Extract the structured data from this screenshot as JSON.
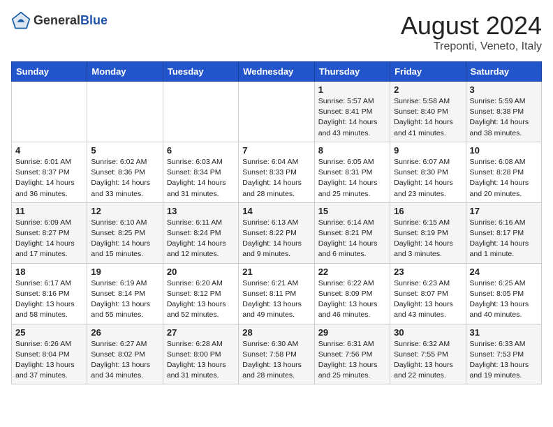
{
  "header": {
    "logo_general": "General",
    "logo_blue": "Blue",
    "month_year": "August 2024",
    "location": "Treponti, Veneto, Italy"
  },
  "days_of_week": [
    "Sunday",
    "Monday",
    "Tuesday",
    "Wednesday",
    "Thursday",
    "Friday",
    "Saturday"
  ],
  "weeks": [
    [
      {
        "day": "",
        "info": ""
      },
      {
        "day": "",
        "info": ""
      },
      {
        "day": "",
        "info": ""
      },
      {
        "day": "",
        "info": ""
      },
      {
        "day": "1",
        "info": "Sunrise: 5:57 AM\nSunset: 8:41 PM\nDaylight: 14 hours and 43 minutes."
      },
      {
        "day": "2",
        "info": "Sunrise: 5:58 AM\nSunset: 8:40 PM\nDaylight: 14 hours and 41 minutes."
      },
      {
        "day": "3",
        "info": "Sunrise: 5:59 AM\nSunset: 8:38 PM\nDaylight: 14 hours and 38 minutes."
      }
    ],
    [
      {
        "day": "4",
        "info": "Sunrise: 6:01 AM\nSunset: 8:37 PM\nDaylight: 14 hours and 36 minutes."
      },
      {
        "day": "5",
        "info": "Sunrise: 6:02 AM\nSunset: 8:36 PM\nDaylight: 14 hours and 33 minutes."
      },
      {
        "day": "6",
        "info": "Sunrise: 6:03 AM\nSunset: 8:34 PM\nDaylight: 14 hours and 31 minutes."
      },
      {
        "day": "7",
        "info": "Sunrise: 6:04 AM\nSunset: 8:33 PM\nDaylight: 14 hours and 28 minutes."
      },
      {
        "day": "8",
        "info": "Sunrise: 6:05 AM\nSunset: 8:31 PM\nDaylight: 14 hours and 25 minutes."
      },
      {
        "day": "9",
        "info": "Sunrise: 6:07 AM\nSunset: 8:30 PM\nDaylight: 14 hours and 23 minutes."
      },
      {
        "day": "10",
        "info": "Sunrise: 6:08 AM\nSunset: 8:28 PM\nDaylight: 14 hours and 20 minutes."
      }
    ],
    [
      {
        "day": "11",
        "info": "Sunrise: 6:09 AM\nSunset: 8:27 PM\nDaylight: 14 hours and 17 minutes."
      },
      {
        "day": "12",
        "info": "Sunrise: 6:10 AM\nSunset: 8:25 PM\nDaylight: 14 hours and 15 minutes."
      },
      {
        "day": "13",
        "info": "Sunrise: 6:11 AM\nSunset: 8:24 PM\nDaylight: 14 hours and 12 minutes."
      },
      {
        "day": "14",
        "info": "Sunrise: 6:13 AM\nSunset: 8:22 PM\nDaylight: 14 hours and 9 minutes."
      },
      {
        "day": "15",
        "info": "Sunrise: 6:14 AM\nSunset: 8:21 PM\nDaylight: 14 hours and 6 minutes."
      },
      {
        "day": "16",
        "info": "Sunrise: 6:15 AM\nSunset: 8:19 PM\nDaylight: 14 hours and 3 minutes."
      },
      {
        "day": "17",
        "info": "Sunrise: 6:16 AM\nSunset: 8:17 PM\nDaylight: 14 hours and 1 minute."
      }
    ],
    [
      {
        "day": "18",
        "info": "Sunrise: 6:17 AM\nSunset: 8:16 PM\nDaylight: 13 hours and 58 minutes."
      },
      {
        "day": "19",
        "info": "Sunrise: 6:19 AM\nSunset: 8:14 PM\nDaylight: 13 hours and 55 minutes."
      },
      {
        "day": "20",
        "info": "Sunrise: 6:20 AM\nSunset: 8:12 PM\nDaylight: 13 hours and 52 minutes."
      },
      {
        "day": "21",
        "info": "Sunrise: 6:21 AM\nSunset: 8:11 PM\nDaylight: 13 hours and 49 minutes."
      },
      {
        "day": "22",
        "info": "Sunrise: 6:22 AM\nSunset: 8:09 PM\nDaylight: 13 hours and 46 minutes."
      },
      {
        "day": "23",
        "info": "Sunrise: 6:23 AM\nSunset: 8:07 PM\nDaylight: 13 hours and 43 minutes."
      },
      {
        "day": "24",
        "info": "Sunrise: 6:25 AM\nSunset: 8:05 PM\nDaylight: 13 hours and 40 minutes."
      }
    ],
    [
      {
        "day": "25",
        "info": "Sunrise: 6:26 AM\nSunset: 8:04 PM\nDaylight: 13 hours and 37 minutes."
      },
      {
        "day": "26",
        "info": "Sunrise: 6:27 AM\nSunset: 8:02 PM\nDaylight: 13 hours and 34 minutes."
      },
      {
        "day": "27",
        "info": "Sunrise: 6:28 AM\nSunset: 8:00 PM\nDaylight: 13 hours and 31 minutes."
      },
      {
        "day": "28",
        "info": "Sunrise: 6:30 AM\nSunset: 7:58 PM\nDaylight: 13 hours and 28 minutes."
      },
      {
        "day": "29",
        "info": "Sunrise: 6:31 AM\nSunset: 7:56 PM\nDaylight: 13 hours and 25 minutes."
      },
      {
        "day": "30",
        "info": "Sunrise: 6:32 AM\nSunset: 7:55 PM\nDaylight: 13 hours and 22 minutes."
      },
      {
        "day": "31",
        "info": "Sunrise: 6:33 AM\nSunset: 7:53 PM\nDaylight: 13 hours and 19 minutes."
      }
    ]
  ]
}
